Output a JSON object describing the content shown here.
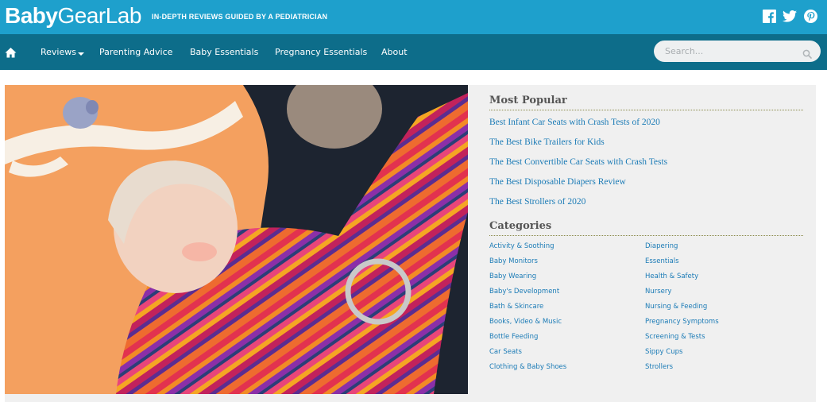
{
  "brand": {
    "logo_part1": "Baby",
    "logo_part2": "GearLab",
    "tagline": "IN-DEPTH REVIEWS GUIDED BY A PEDIATRICIAN"
  },
  "social": [
    "facebook-icon",
    "twitter-icon",
    "pinterest-icon"
  ],
  "nav": {
    "home_icon": "home-icon",
    "items": [
      "Reviews",
      "Parenting Advice",
      "Baby Essentials",
      "Pregnancy Essentials",
      "About"
    ]
  },
  "search": {
    "placeholder": "Search...",
    "icon": "search-icon"
  },
  "hero": {
    "alt": "Baby in a striped ring sling carrier"
  },
  "sidebar": {
    "most_popular_title": "Most Popular",
    "most_popular": [
      "Best Infant Car Seats with Crash Tests of 2020",
      "The Best Bike Trailers for Kids",
      "The Best Convertible Car Seats with Crash Tests",
      "The Best Disposable Diapers Review",
      "The Best Strollers of 2020"
    ],
    "categories_title": "Categories",
    "categories_left": [
      "Activity & Soothing",
      "Baby Monitors",
      "Baby Wearing",
      "Baby's Development",
      "Bath & Skincare",
      "Books, Video & Music",
      "Bottle Feeding",
      "Car Seats",
      "Clothing & Baby Shoes"
    ],
    "categories_right": [
      "Diapering",
      "Essentials",
      "Health & Safety",
      "Nursery",
      "Nursing & Feeding",
      "Pregnancy Symptoms",
      "Screening & Tests",
      "Sippy Cups",
      "Strollers"
    ]
  },
  "colors": {
    "topbar": "#1ea0cc",
    "navbar": "#0d6d8a",
    "link": "#1b7bb6",
    "panel": "#f0f0f0"
  }
}
